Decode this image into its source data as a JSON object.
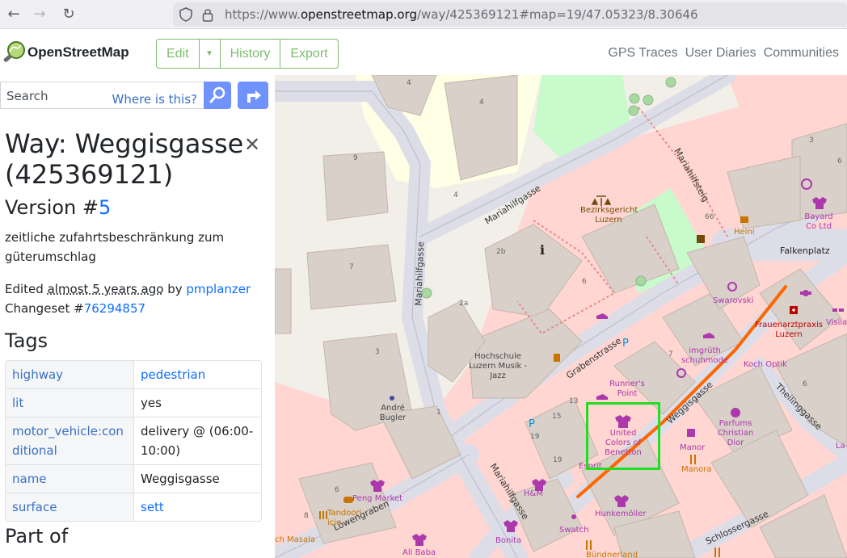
{
  "browser": {
    "url_prefix": "https://www.",
    "url_domain": "openstreetmap.org",
    "url_rest": "/way/425369121#map=19/47.05323/8.30646"
  },
  "header": {
    "brand": "OpenStreetMap",
    "edit_label": "Edit",
    "history_label": "History",
    "export_label": "Export",
    "links": [
      "GPS Traces",
      "User Diaries",
      "Communities"
    ]
  },
  "sidebar": {
    "search_placeholder": "Search",
    "where_is_this": "Where is this?",
    "title_line1": "Way: Weggisgasse",
    "title_line2": "(425369121)",
    "version_prefix": "Version #",
    "version_number": "5",
    "description": "zeitliche zufahrtsbeschränkung zum güterumschlag",
    "edited_prefix": "Edited ",
    "edited_when": "almost 5 years ago",
    "edited_by": " by ",
    "edited_user": "pmplanzer",
    "changeset_prefix": "Changeset #",
    "changeset_id": "76294857",
    "tags_heading": "Tags",
    "tags": [
      {
        "key": "highway",
        "value": "pedestrian",
        "value_is_link": true
      },
      {
        "key": "lit",
        "value": "yes",
        "value_is_link": false
      },
      {
        "key": "motor_vehicle:conditional",
        "value": "delivery @ (06:00-10:00)",
        "value_is_link": false
      },
      {
        "key": "name",
        "value": "Weggisgasse",
        "value_is_link": false
      },
      {
        "key": "surface",
        "value": "sett",
        "value_is_link": true
      }
    ],
    "part_of_heading": "Part of"
  },
  "map": {
    "streets": [
      "Mariahilfgasse",
      "Mariahilfgasse",
      "Mariahilfsteig",
      "Grabenstrasse",
      "Weggisgasse",
      "Mariahilfgasse",
      "Löwengraben",
      "Theilinggasse",
      "Schlossergasse"
    ],
    "places": [
      "Falkenplatz"
    ],
    "pois": {
      "court": "Bezirksgericht Luzern",
      "school": "Hochschule Luzern Musik - Jazz",
      "cafe": "Heini",
      "bayard": "Bayard Co Ltd",
      "swarovski": "Swarovski",
      "clinic": "Frauenarztpraxis Luzern",
      "imgruth": "imgrüth schuhmode",
      "koch": "Koch Optik",
      "runners": "Runner's Point",
      "andre": "André Bugler",
      "benetton": "United Colors of Benetton",
      "parfums": "Parfums Christian Dior",
      "manor": "Manor",
      "manora": "Manora",
      "esprit": "Esprit",
      "hm": "H&M",
      "peng": "Peng Market",
      "tandoori": "Tandoori icio",
      "masala": "ch Masala",
      "hunkemoller": "Hunkemöller",
      "swatch": "Swatch",
      "bonita": "Bonita",
      "alibaba": "Ali Baba",
      "bundnerland": "Bündnerland",
      "visilab": "Visilal",
      "la": "La"
    },
    "house_numbers": [
      "4",
      "4",
      "9",
      "4",
      "7",
      "3",
      "1",
      "2b",
      "2a",
      "6",
      "7",
      "13",
      "15",
      "19",
      "19",
      "6",
      "8",
      "66",
      "6",
      "3",
      "6"
    ],
    "colors": {
      "pedestrian": "#dddde8",
      "building": "#d9d0c9",
      "highlight": "#ff6600",
      "selection": "#22dd22",
      "park": "#c8facc",
      "school": "#ffffe5",
      "retail": "#ffd6d1"
    }
  }
}
